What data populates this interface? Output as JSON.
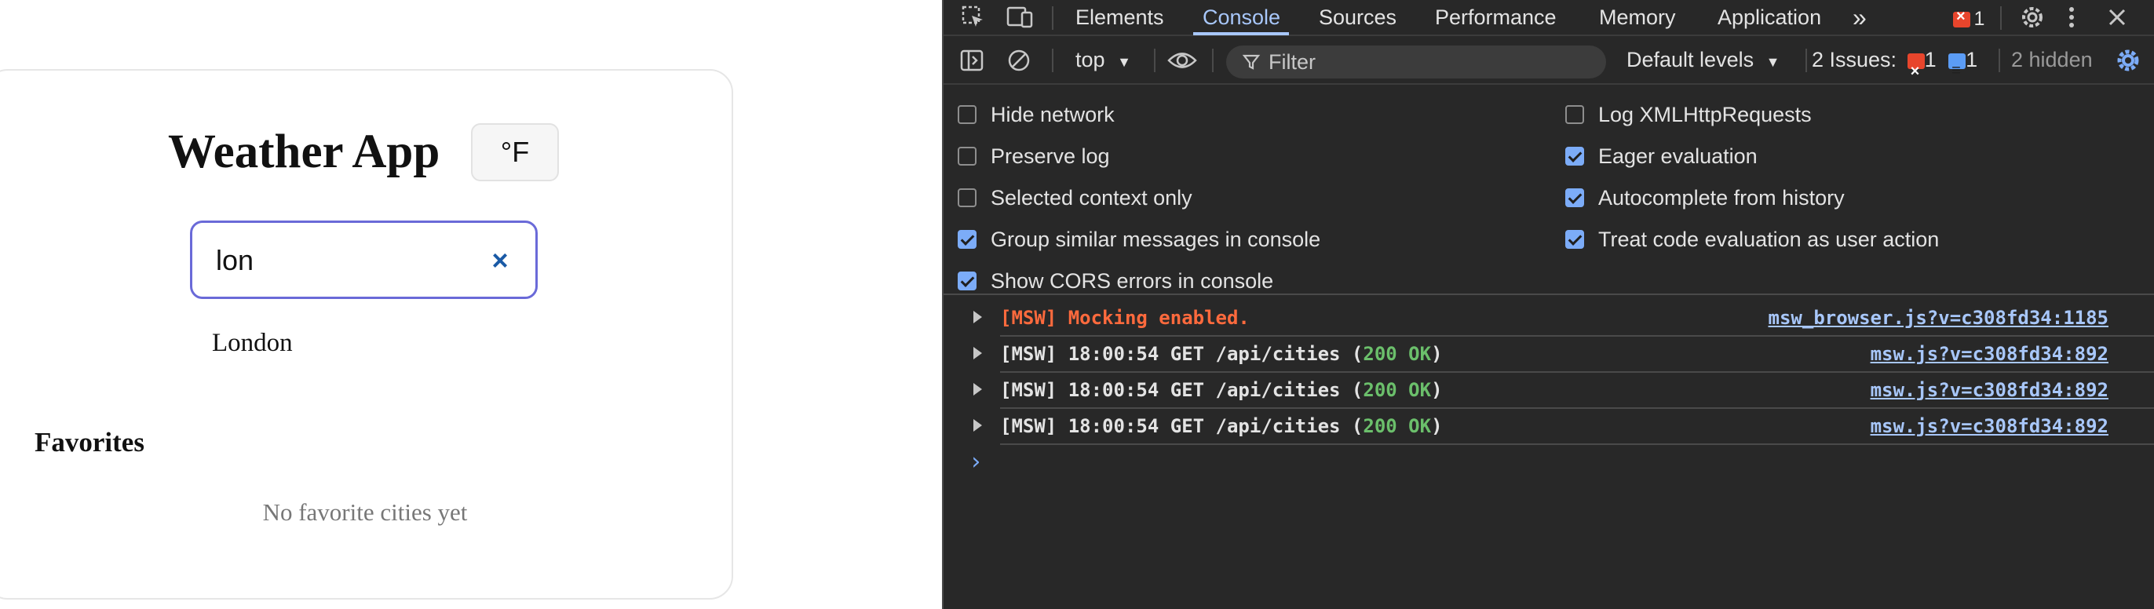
{
  "app": {
    "title": "Weather App",
    "unit_toggle": "°F",
    "search": {
      "value": "lon",
      "clear_icon": "×"
    },
    "suggestions": [
      "London"
    ],
    "favorites": {
      "heading": "Favorites",
      "empty_text": "No favorite cities yet"
    }
  },
  "devtools": {
    "tabs": [
      "Elements",
      "Console",
      "Sources",
      "Performance",
      "Memory",
      "Application"
    ],
    "active_tab": "Console",
    "more_tabs": "»",
    "error_count": "1",
    "toolbar": {
      "context": "top",
      "filter_placeholder": "Filter",
      "levels": "Default levels",
      "issues_label": "2 Issues:",
      "issues_errors": "1",
      "issues_info": "1",
      "hidden": "2 hidden"
    },
    "settings_left": [
      {
        "label": "Hide network",
        "checked": false
      },
      {
        "label": "Preserve log",
        "checked": false
      },
      {
        "label": "Selected context only",
        "checked": false
      },
      {
        "label": "Group similar messages in console",
        "checked": true
      },
      {
        "label": "Show CORS errors in console",
        "checked": true
      }
    ],
    "settings_right": [
      {
        "label": "Log XMLHttpRequests",
        "checked": false
      },
      {
        "label": "Eager evaluation",
        "checked": true
      },
      {
        "label": "Autocomplete from history",
        "checked": true
      },
      {
        "label": "Treat code evaluation as user action",
        "checked": true
      }
    ],
    "log": [
      {
        "prefix": "[MSW] Mocking enabled.",
        "mid": "",
        "status": "",
        "suffix": "",
        "source": "msw_browser.js?v=c308fd34:1185"
      },
      {
        "prefix": "[MSW] 18:00:54 GET /api/cities (",
        "mid": "",
        "status": "200 OK",
        "suffix": ")",
        "source": "msw.js?v=c308fd34:892"
      },
      {
        "prefix": "[MSW] 18:00:54 GET /api/cities (",
        "mid": "",
        "status": "200 OK",
        "suffix": ")",
        "source": "msw.js?v=c308fd34:892"
      },
      {
        "prefix": "[MSW] 18:00:54 GET /api/cities (",
        "mid": "",
        "status": "200 OK",
        "suffix": ")",
        "source": "msw.js?v=c308fd34:892"
      }
    ],
    "prompt": "›",
    "colors": {
      "accent": "#a8c7fa",
      "error": "#ff6a3d",
      "success": "#6bbf6b",
      "background": "#282828"
    }
  }
}
